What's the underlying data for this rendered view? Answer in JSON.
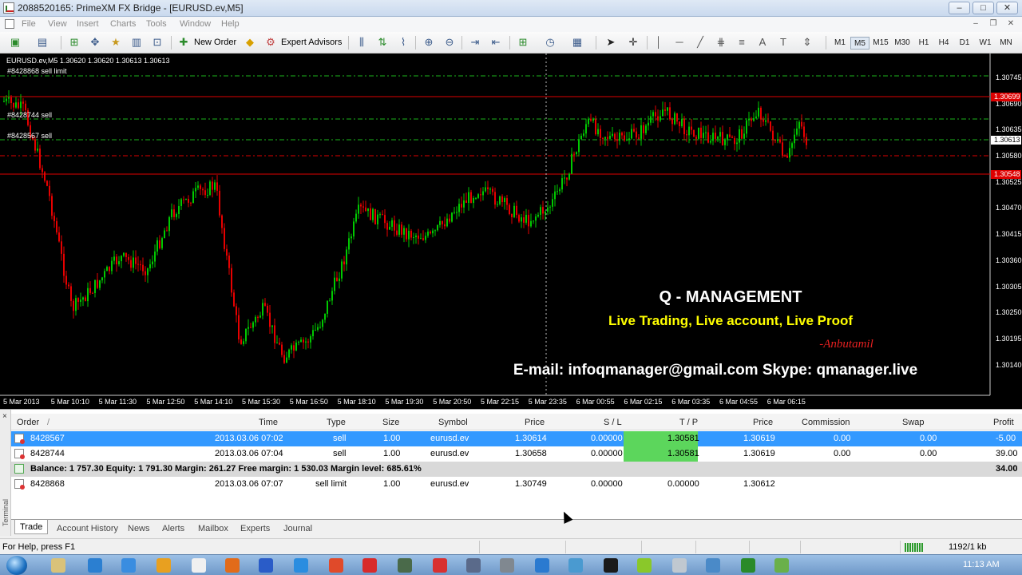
{
  "window": {
    "title": "2088520165: PrimeXM FX Bridge - [EURUSD.ev,M5]",
    "minimize": "–",
    "maximize": "□",
    "close": "✕"
  },
  "menu": [
    "File",
    "View",
    "Insert",
    "Charts",
    "Tools",
    "Window",
    "Help"
  ],
  "toolbar": {
    "new_order": "New Order",
    "expert_advisors": "Expert Advisors",
    "timeframes": [
      "M1",
      "M5",
      "M15",
      "M30",
      "H1",
      "H4",
      "D1",
      "W1",
      "MN"
    ],
    "active_timeframe": "M5"
  },
  "chart": {
    "header": "EURUSD.ev,M5  1.30620 1.30620 1.30613 1.30613",
    "order_labels": {
      "sell_limit": "#8428868 sell limit",
      "sell_1": "#8428744 sell",
      "sell_2": "#8428567 sell"
    },
    "price_labels": [
      "1.30745",
      "1.30690",
      "1.30635",
      "1.30580",
      "1.30525",
      "1.30470",
      "1.30415",
      "1.30360",
      "1.30305",
      "1.30250",
      "1.30195",
      "1.30140"
    ],
    "highlight_labels": {
      "top_red": "1.30699",
      "current": "1.30613",
      "bottom_red": "1.30548"
    },
    "time_labels": [
      "5 Mar 2013",
      "5 Mar 10:10",
      "5 Mar 11:30",
      "5 Mar 12:50",
      "5 Mar 14:10",
      "5 Mar 15:30",
      "5 Mar 16:50",
      "5 Mar 18:10",
      "5 Mar 19:30",
      "5 Mar 20:50",
      "5 Mar 22:15",
      "5 Mar 23:35",
      "6 Mar 00:55",
      "6 Mar 02:15",
      "6 Mar 03:35",
      "6 Mar 04:55",
      "6 Mar 06:15"
    ],
    "colors": {
      "bull": "#00c800",
      "bear": "#e60000",
      "background": "#000000"
    }
  },
  "promo": {
    "title": "Q - MANAGEMENT",
    "subtitle": "Live Trading, Live account, Live Proof",
    "signature": "-Anbutamil",
    "contact": "E-mail: infoqmanager@gmail.com Skype: qmanager.live"
  },
  "terminal": {
    "side_label": "Terminal",
    "close": "×",
    "columns": {
      "order": "Order",
      "sort": "/",
      "time": "Time",
      "type": "Type",
      "size": "Size",
      "symbol": "Symbol",
      "price": "Price",
      "sl": "S / L",
      "tp": "T / P",
      "price2": "Price",
      "commission": "Commission",
      "swap": "Swap",
      "profit": "Profit"
    },
    "rows": [
      {
        "order": "8428567",
        "time": "2013.03.06 07:02",
        "type": "sell",
        "size": "1.00",
        "symbol": "eurusd.ev",
        "price": "1.30614",
        "sl": "0.00000",
        "tp": "1.30581",
        "cur": "1.30619",
        "commission": "0.00",
        "swap": "0.00",
        "profit": "-5.00"
      },
      {
        "order": "8428744",
        "time": "2013.03.06 07:04",
        "type": "sell",
        "size": "1.00",
        "symbol": "eurusd.ev",
        "price": "1.30658",
        "sl": "0.00000",
        "tp": "1.30581",
        "cur": "1.30619",
        "commission": "0.00",
        "swap": "0.00",
        "profit": "39.00"
      }
    ],
    "balance_line": "Balance: 1 757.30  Equity: 1 791.30  Margin: 261.27  Free margin: 1 530.03  Margin level: 685.61%",
    "balance_profit": "34.00",
    "pending": {
      "order": "8428868",
      "time": "2013.03.06 07:07",
      "type": "sell limit",
      "size": "1.00",
      "symbol": "eurusd.ev",
      "price": "1.30749",
      "sl": "0.00000",
      "tp": "0.00000",
      "cur": "1.30612"
    },
    "tabs": [
      "Trade",
      "Account History",
      "News",
      "Alerts",
      "Mailbox",
      "Experts",
      "Journal"
    ]
  },
  "status": {
    "help": "For Help, press F1",
    "traffic": "1192/1 kb"
  },
  "taskbar": {
    "clock": "11:13 AM"
  }
}
